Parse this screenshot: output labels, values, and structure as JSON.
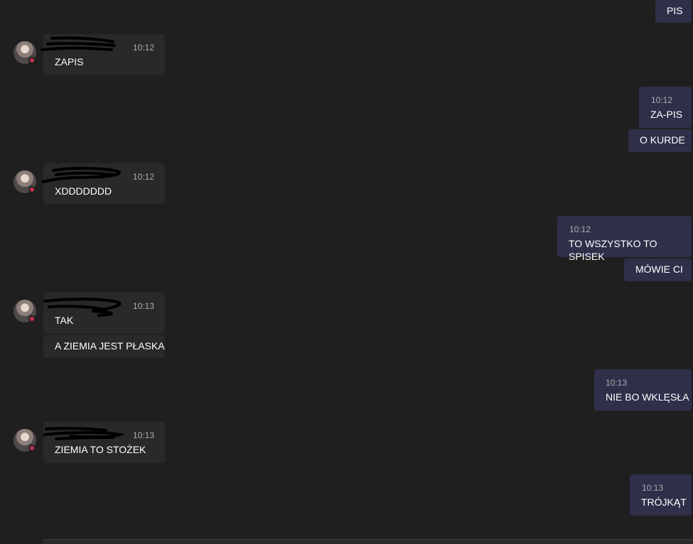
{
  "messages": {
    "m1": {
      "text": "PIS"
    },
    "m2": {
      "time": "10:12",
      "text": "ZAPIS"
    },
    "m3": {
      "time": "10:12",
      "text": "ZA-PIS"
    },
    "m4": {
      "text": "O KURDE"
    },
    "m5": {
      "time": "10:12",
      "text": "XDDDDDDD"
    },
    "m6": {
      "time": "10:12",
      "text": "TO WSZYSTKO TO SPISEK"
    },
    "m7": {
      "text": "MÓWIE CI"
    },
    "m8": {
      "time": "10:13",
      "text": "TAK"
    },
    "m9": {
      "text": "A ZIEMIA JEST PŁASKA"
    },
    "m10": {
      "time": "10:13",
      "text": "NIE BO WKLĘSŁA"
    },
    "m11": {
      "time": "10:13",
      "text": "ZIEMIA TO STOŻEK"
    },
    "m12": {
      "time": "10:13",
      "text": "TRÓJKĄT"
    }
  },
  "colors": {
    "background": "#1f1f1f",
    "outgoing_bubble": "#2f2f4a",
    "incoming_bubble": "#292929",
    "presence_busy": "#c4314b"
  }
}
